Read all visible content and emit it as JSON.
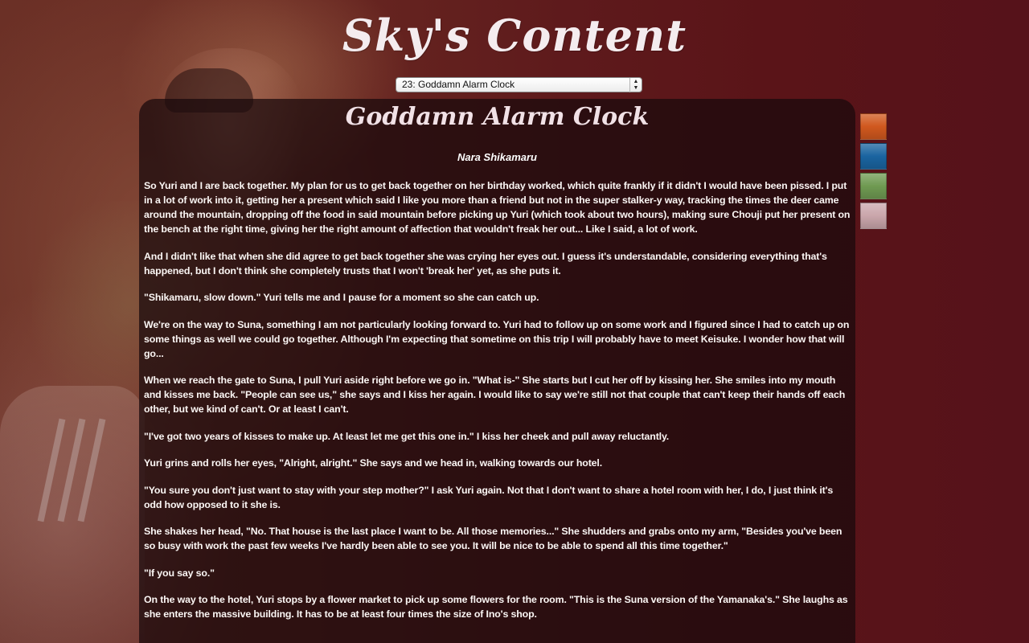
{
  "site": {
    "title": "Sky's Content"
  },
  "chapter_select": {
    "selected": "23: Goddamn Alarm Clock"
  },
  "chapter": {
    "title": "Goddamn Alarm Clock",
    "pov": "Nara Shikamaru",
    "paragraphs": [
      "So Yuri and I are back together. My plan for us to get back together on her birthday worked, which quite frankly if it didn't I would have been pissed. I put in a lot of work into it, getting her a present which said I like you more than a friend but not in the super stalker-y way, tracking the times the deer came around the mountain, dropping off the food in said mountain before picking up Yuri (which took about two hours), making sure Chouji put her present on the bench at the right time, giving her the right amount of affection that wouldn't freak her out... Like I said, a lot of work.",
      "And I didn't like that when she did agree to get back together she was crying her eyes out. I guess it's understandable, considering everything that's happened, but I don't think she completely trusts that I won't 'break her' yet, as she puts it.",
      "\"Shikamaru, slow down.\" Yuri tells me and I pause for a moment so she can catch up.",
      "We're on the way to Suna, something I am not particularly looking forward to. Yuri had to follow up on some work and I figured since I had to catch up on some things as well we could go together. Although I'm expecting that sometime on this trip I will probably have to meet Keisuke. I wonder how that will go...",
      "When we reach the gate to Suna, I pull Yuri aside right before we go in. \"What is-\" She starts but I cut her off by kissing her. She smiles into my mouth and kisses me back. \"People can see us,\" she says and I kiss her again. I would like to say we're still not that couple that can't keep their hands off each other, but we kind of can't. Or at least I can't.",
      "\"I've got two years of kisses to make up. At least let me get this one in.\" I kiss her cheek and pull away reluctantly.",
      "Yuri grins and rolls her eyes, \"Alright, alright.\" She says and we head in, walking towards our hotel.",
      "\"You sure you don't just want to stay with your step mother?\" I ask Yuri again. Not that I don't want to share a hotel room with her, I do, I just think it's odd how opposed to it she is.",
      "She shakes her head, \"No. That house is the last place I want to be. All those memories...\" She shudders and grabs onto my arm, \"Besides you've been so busy with work the past few weeks I've hardly been able to see you. It will be nice to be able to spend all this time together.\"",
      "\"If you say so.\"",
      "On the way to the hotel, Yuri stops by a flower market to pick up some flowers for the room. \"This is the Suna version of the Yamanaka's.\" She laughs as she enters the massive building. It has to be at least four times the size of Ino's shop."
    ]
  },
  "theme_swatches": [
    {
      "name": "orange",
      "color": "#d0581e"
    },
    {
      "name": "blue",
      "color": "#1a64a0"
    },
    {
      "name": "green",
      "color": "#6f9a52"
    },
    {
      "name": "rose",
      "color": "#caa6ab"
    }
  ],
  "colors": {
    "background": "#5a1418",
    "text": "#fbf6f4",
    "panel": "#1a0a0c"
  }
}
